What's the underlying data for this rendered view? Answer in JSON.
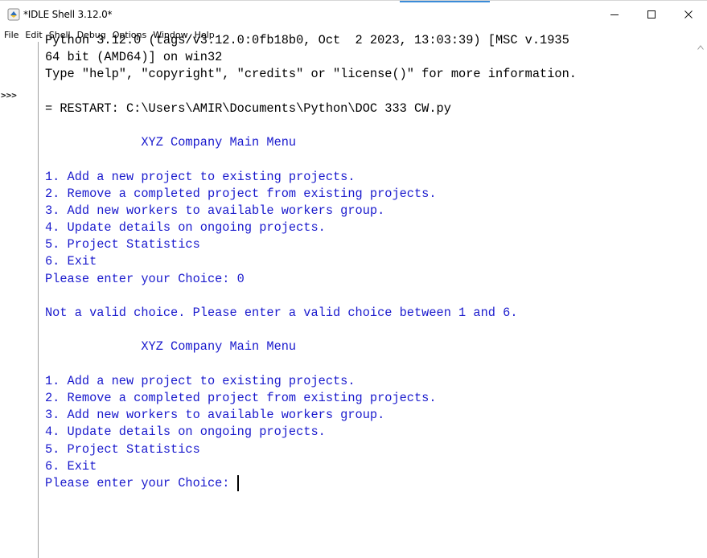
{
  "window": {
    "title": "*IDLE Shell 3.12.0*",
    "app_icon": "idle-python-icon",
    "controls": {
      "minimize": "minimize-icon",
      "maximize": "maximize-icon",
      "close": "close-icon"
    }
  },
  "menubar": {
    "items": [
      "File",
      "Edit",
      "Shell",
      "Debug",
      "Options",
      "Window",
      "Help"
    ]
  },
  "gutter": {
    "prompt": ">>>"
  },
  "shell": {
    "lines": [
      {
        "kind": "info",
        "text": "Python 3.12.0 (tags/v3.12.0:0fb18b0, Oct  2 2023, 13:03:39) [MSC v.1935"
      },
      {
        "kind": "info",
        "text": "64 bit (AMD64)] on win32"
      },
      {
        "kind": "info",
        "text": "Type \"help\", \"copyright\", \"credits\" or \"license()\" for more information."
      },
      {
        "kind": "blank",
        "text": ""
      },
      {
        "kind": "info",
        "text": "= RESTART: C:\\Users\\AMIR\\Documents\\Python\\DOC 333 CW.py"
      },
      {
        "kind": "blank",
        "text": ""
      },
      {
        "kind": "stdout",
        "text": "             XYZ Company Main Menu"
      },
      {
        "kind": "blank",
        "text": ""
      },
      {
        "kind": "stdout",
        "text": "1. Add a new project to existing projects."
      },
      {
        "kind": "stdout",
        "text": "2. Remove a completed project from existing projects."
      },
      {
        "kind": "stdout",
        "text": "3. Add new workers to available workers group."
      },
      {
        "kind": "stdout",
        "text": "4. Update details on ongoing projects."
      },
      {
        "kind": "stdout",
        "text": "5. Project Statistics"
      },
      {
        "kind": "stdout",
        "text": "6. Exit"
      },
      {
        "kind": "stdout",
        "text": "Please enter your Choice: 0"
      },
      {
        "kind": "blank",
        "text": ""
      },
      {
        "kind": "stdout",
        "text": "Not a valid choice. Please enter a valid choice between 1 and 6."
      },
      {
        "kind": "blank",
        "text": ""
      },
      {
        "kind": "stdout",
        "text": "             XYZ Company Main Menu"
      },
      {
        "kind": "blank",
        "text": ""
      },
      {
        "kind": "stdout",
        "text": "1. Add a new project to existing projects."
      },
      {
        "kind": "stdout",
        "text": "2. Remove a completed project from existing projects."
      },
      {
        "kind": "stdout",
        "text": "3. Add new workers to available workers group."
      },
      {
        "kind": "stdout",
        "text": "4. Update details on ongoing projects."
      },
      {
        "kind": "stdout",
        "text": "5. Project Statistics"
      },
      {
        "kind": "stdout",
        "text": "6. Exit"
      }
    ],
    "input_prompt": "Please enter your Choice: "
  },
  "colors": {
    "stdout": "#1a1acd",
    "info": "#000000",
    "background": "#ffffff"
  }
}
